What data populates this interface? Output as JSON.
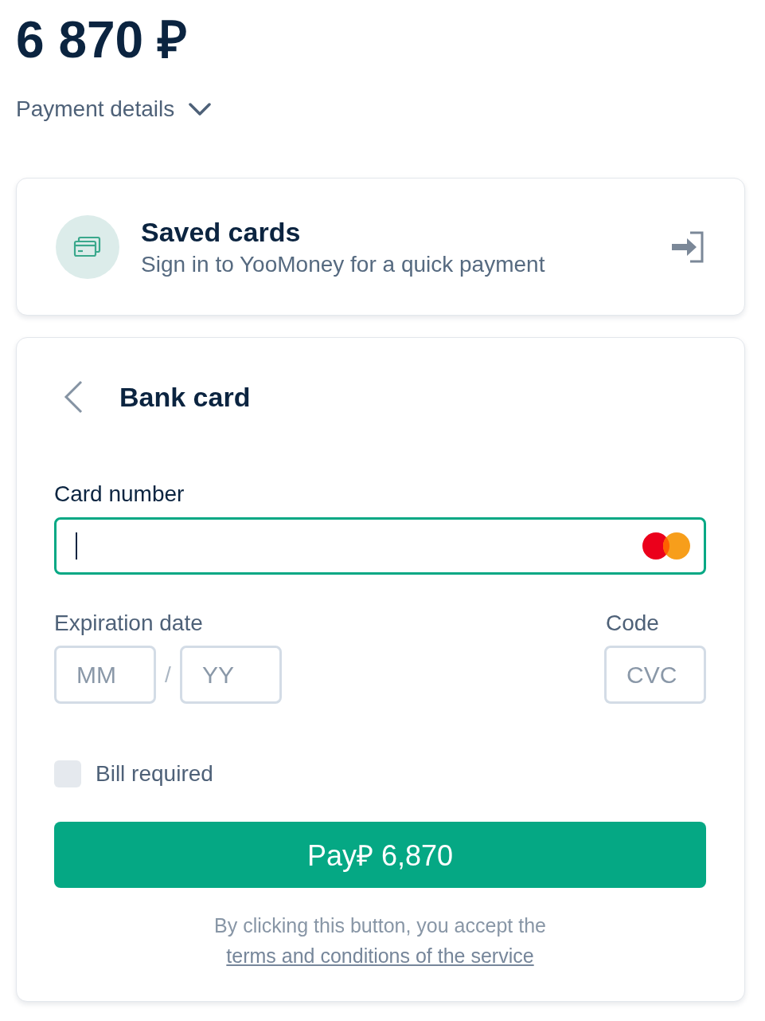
{
  "amount": "6 870 ₽",
  "details_toggle": {
    "label": "Payment details",
    "expanded": false
  },
  "saved_cards": {
    "title": "Saved cards",
    "subtitle": "Sign in to YooMoney for a quick payment"
  },
  "bank_card": {
    "title": "Bank card",
    "card_number": {
      "label": "Card number",
      "focused": true
    },
    "expiration": {
      "label": "Expiration date",
      "month": {
        "placeholder": "MM"
      },
      "separator": "/",
      "year": {
        "placeholder": "YY"
      }
    },
    "code": {
      "label": "Code",
      "placeholder": "CVC"
    },
    "bill_required": {
      "label": "Bill required",
      "checked": false
    },
    "pay_button": "Pay₽ 6,870",
    "terms": {
      "text": "By clicking this button, you accept the",
      "link": "terms and conditions of the service"
    }
  }
}
